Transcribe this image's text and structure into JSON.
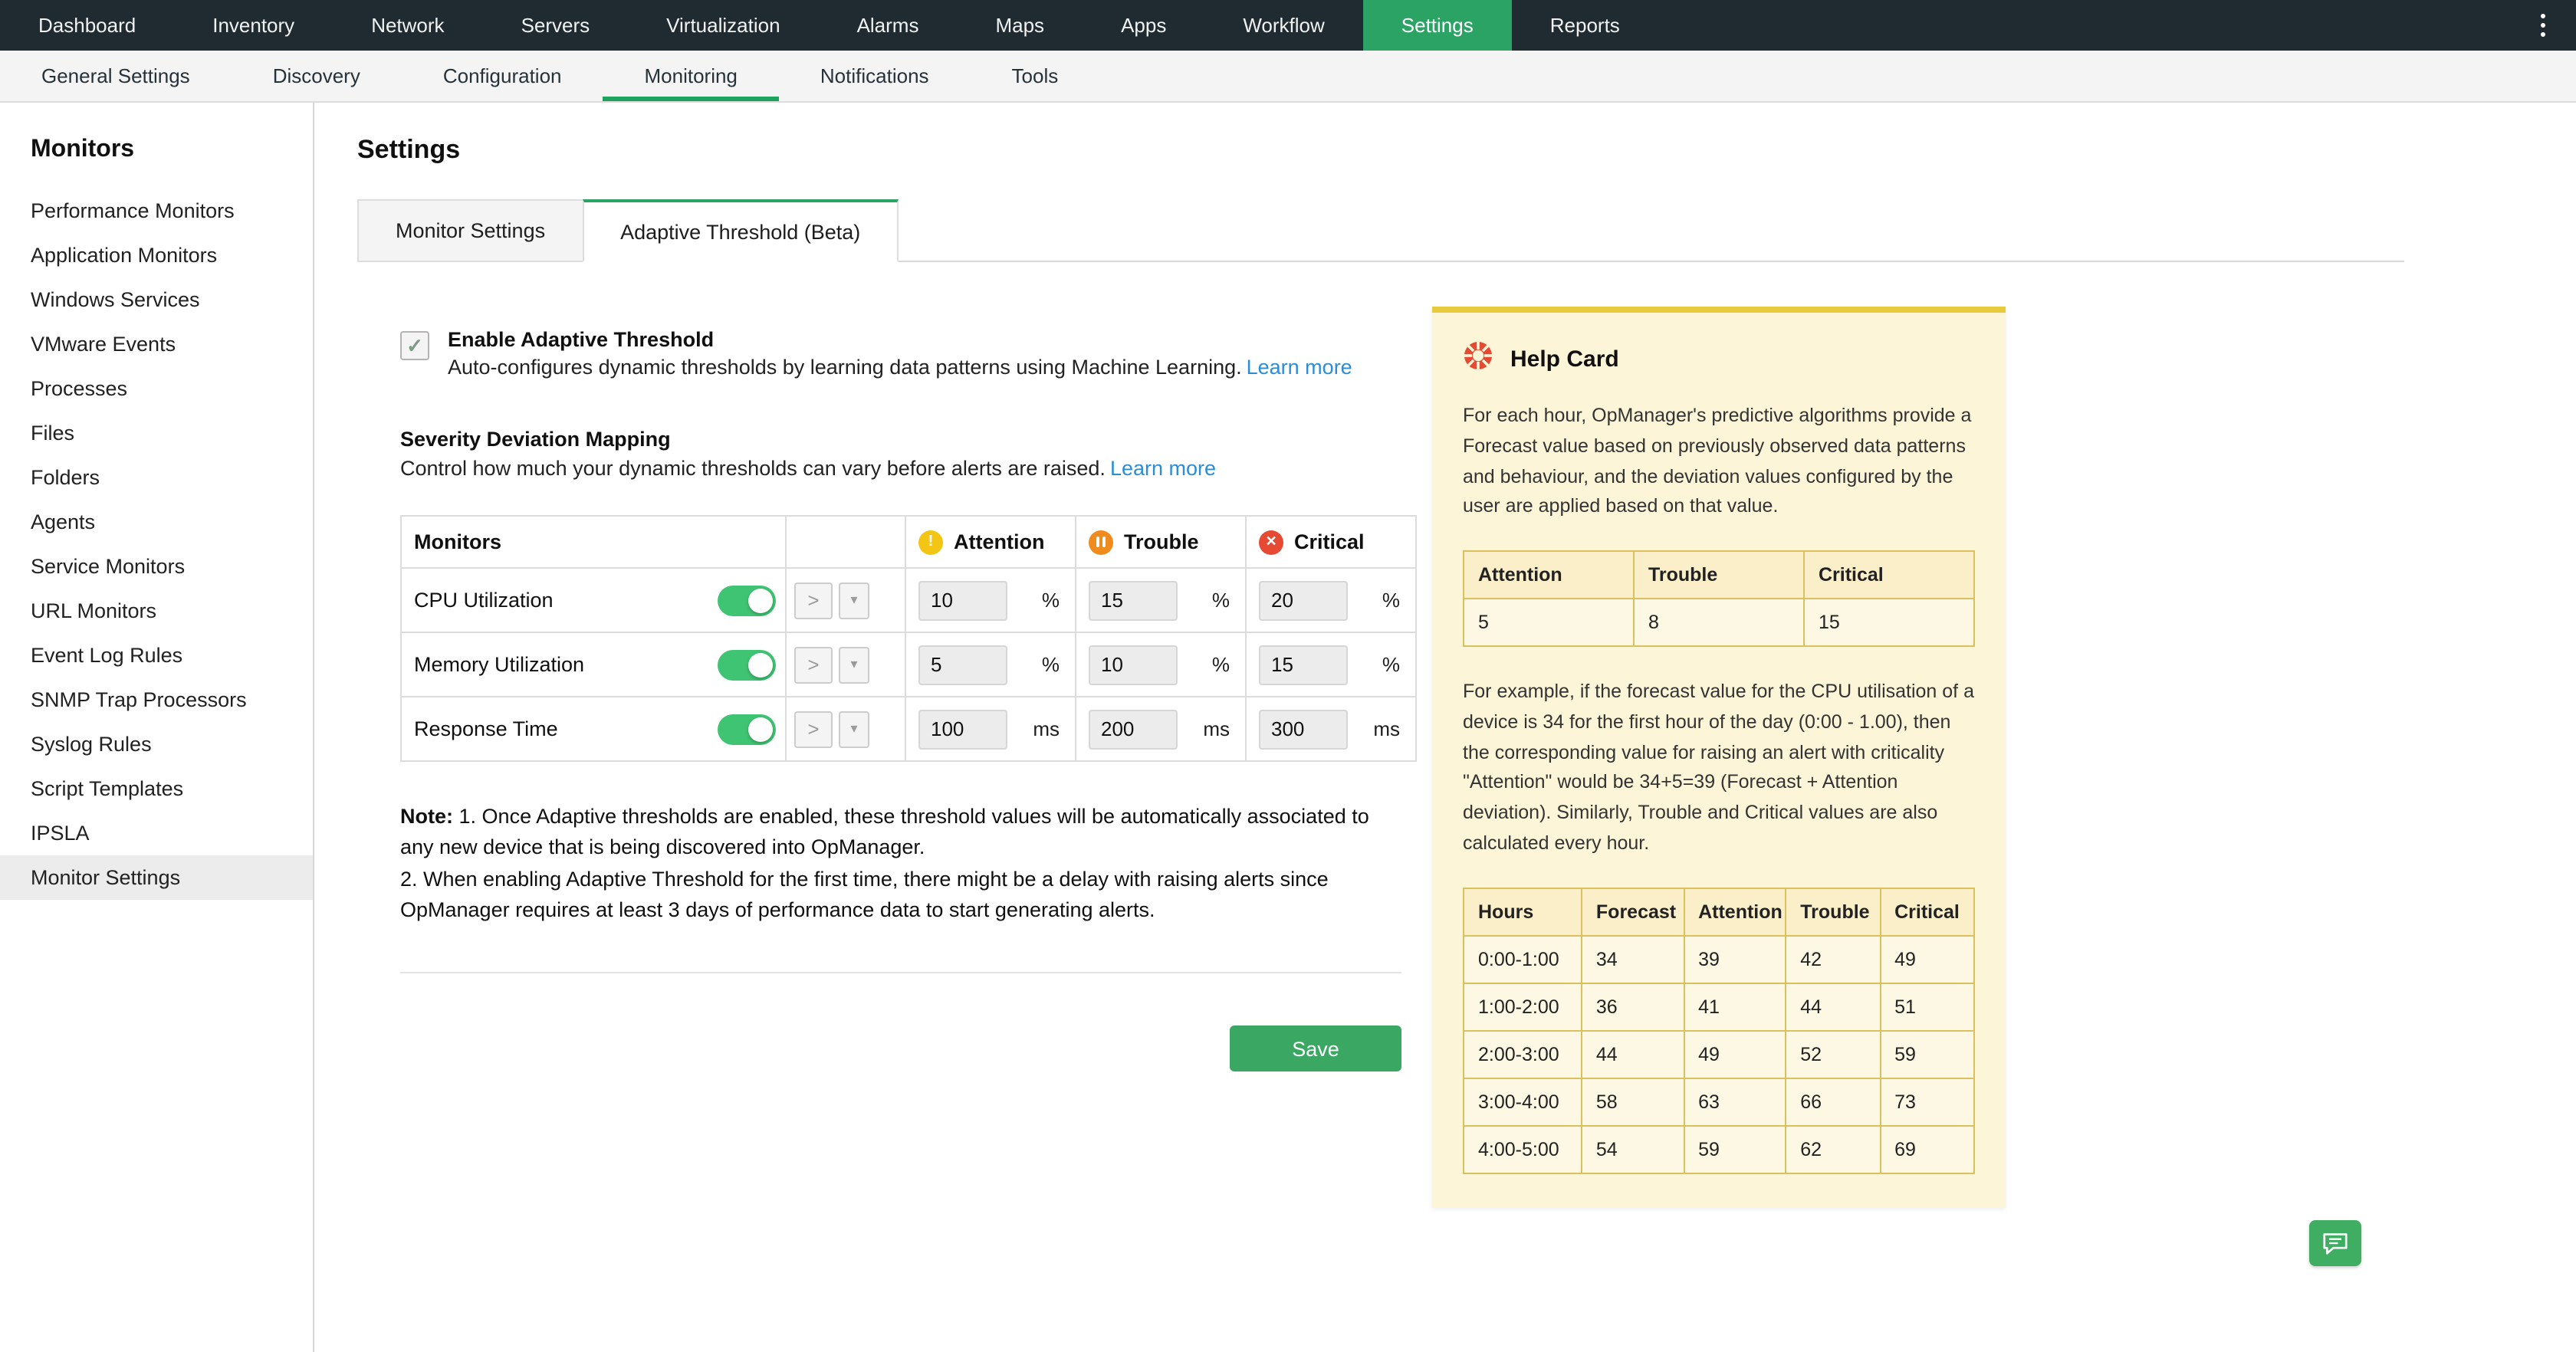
{
  "topnav": {
    "items": [
      "Dashboard",
      "Inventory",
      "Network",
      "Servers",
      "Virtualization",
      "Alarms",
      "Maps",
      "Apps",
      "Workflow",
      "Settings",
      "Reports"
    ],
    "active": "Settings"
  },
  "subnav": {
    "items": [
      "General Settings",
      "Discovery",
      "Configuration",
      "Monitoring",
      "Notifications",
      "Tools"
    ],
    "active": "Monitoring"
  },
  "sidebar": {
    "title": "Monitors",
    "items": [
      "Performance Monitors",
      "Application Monitors",
      "Windows Services",
      "VMware Events",
      "Processes",
      "Files",
      "Folders",
      "Agents",
      "Service Monitors",
      "URL Monitors",
      "Event Log Rules",
      "SNMP Trap Processors",
      "Syslog Rules",
      "Script Templates",
      "IPSLA",
      "Monitor Settings"
    ],
    "selected": "Monitor Settings"
  },
  "main": {
    "title": "Settings",
    "tabs": [
      "Monitor Settings",
      "Adaptive Threshold (Beta)"
    ],
    "active_tab": "Adaptive Threshold (Beta)",
    "enable": {
      "checked": true,
      "label": "Enable Adaptive Threshold",
      "description": "Auto-configures dynamic thresholds by learning data patterns using Machine Learning.",
      "learn_more": "Learn more"
    },
    "mapping": {
      "title": "Severity Deviation Mapping",
      "description": "Control how much your dynamic thresholds can vary before alerts are raised.",
      "learn_more": "Learn more"
    },
    "table": {
      "headers": {
        "monitors": "Monitors",
        "attention": "Attention",
        "trouble": "Trouble",
        "critical": "Critical"
      },
      "rows": [
        {
          "name": "CPU Utilization",
          "enabled": true,
          "operator": ">",
          "attention": "10",
          "trouble": "15",
          "critical": "20",
          "unit": "%"
        },
        {
          "name": "Memory Utilization",
          "enabled": true,
          "operator": ">",
          "attention": "5",
          "trouble": "10",
          "critical": "15",
          "unit": "%"
        },
        {
          "name": "Response Time",
          "enabled": true,
          "operator": ">",
          "attention": "100",
          "trouble": "200",
          "critical": "300",
          "unit": "ms"
        }
      ]
    },
    "note_label": "Note:",
    "note_1": "1. Once Adaptive thresholds are enabled, these threshold values will be automatically associated to any new device that is being discovered into OpManager.",
    "note_2": "2. When enabling Adaptive Threshold for the first time, there might be a delay with raising alerts since OpManager requires at least 3 days of performance data to start generating alerts.",
    "save_label": "Save"
  },
  "help_card": {
    "title": "Help Card",
    "para1": "For each hour, OpManager's predictive algorithms provide a Forecast value based on previously observed data patterns and behaviour, and the deviation values configured by the user are applied based on that value.",
    "deviation_table": {
      "headers": [
        "Attention",
        "Trouble",
        "Critical"
      ],
      "values": [
        "5",
        "8",
        "15"
      ]
    },
    "para2": "For example, if the forecast value for the CPU utilisation of a device is 34 for the first hour of the day (0:00 - 1.00), then the corresponding value for raising an alert with criticality \"Attention\" would be 34+5=39 (Forecast + Attention deviation). Similarly, Trouble and Critical values are also calculated every hour.",
    "forecast_table": {
      "headers": [
        "Hours",
        "Forecast",
        "Attention",
        "Trouble",
        "Critical"
      ],
      "rows": [
        [
          "0:00-1:00",
          "34",
          "39",
          "42",
          "49"
        ],
        [
          "1:00-2:00",
          "36",
          "41",
          "44",
          "51"
        ],
        [
          "2:00-3:00",
          "44",
          "49",
          "52",
          "59"
        ],
        [
          "3:00-4:00",
          "58",
          "63",
          "66",
          "73"
        ],
        [
          "4:00-5:00",
          "54",
          "59",
          "62",
          "69"
        ]
      ]
    }
  },
  "icons": {
    "caret_down": "▾",
    "check": "✓",
    "attention_mark": "!",
    "critical_mark": "✕"
  },
  "colors": {
    "accent_green": "#2aa365",
    "save_green": "#3aa763",
    "link_blue": "#2d8cd4",
    "attention_yellow": "#f3c515",
    "trouble_orange": "#f08b1d",
    "critical_red": "#e64a33",
    "help_card_bg": "#fcf5d7",
    "topnav_bg": "#1f2b31"
  }
}
